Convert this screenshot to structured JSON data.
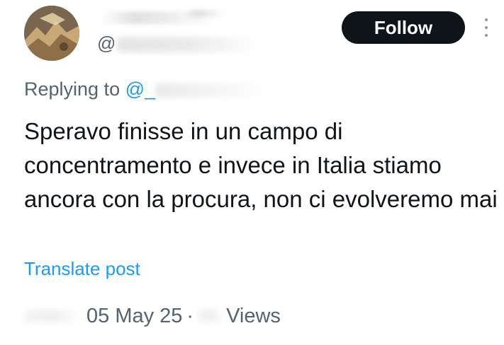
{
  "author": {
    "handle_prefix": "@"
  },
  "follow_button": {
    "label": "Follow"
  },
  "reply_context": {
    "prefix": "Replying to",
    "mention_prefix": "@_"
  },
  "post": {
    "text": "Speravo finisse in un campo di concentramento e invece in Italia stiamo ancora con la procura, non ci evolveremo mai"
  },
  "translate": {
    "label": "Translate post"
  },
  "meta": {
    "date": "05 May 25",
    "separator": "·",
    "views_label": "Views"
  },
  "colors": {
    "text": "#0f1419",
    "secondary": "#536471",
    "link": "#1d9bf0",
    "button_bg": "#0f1419",
    "button_text": "#ffffff"
  },
  "icons": {
    "more": "more-vertical-icon",
    "avatar": "avatar-image"
  }
}
